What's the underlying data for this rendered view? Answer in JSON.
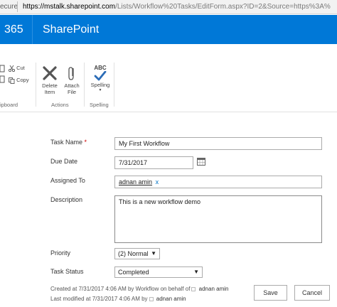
{
  "address_bar": {
    "security": "ecure",
    "url_host": "https://mstalk.sharepoint.com",
    "url_rest": "/Lists/Workflow%20Tasks/EditForm.aspx?ID=2&Source=https%3A%"
  },
  "suite_bar": {
    "product": "365",
    "site": "SharePoint"
  },
  "ribbon": {
    "cut_label": "Cut",
    "copy_label": "Copy",
    "clipboard_group": "ipboard",
    "delete_label": "Delete Item",
    "attach_label": "Attach File",
    "actions_group": "Actions",
    "spelling_abc": "ABC",
    "spelling_label": "Spelling",
    "spelling_group": "Spelling"
  },
  "form": {
    "task_name": {
      "label": "Task Name",
      "required": "*",
      "value": "My First Workflow"
    },
    "due_date": {
      "label": "Due Date",
      "value": "7/31/2017"
    },
    "assigned_to": {
      "label": "Assigned To",
      "value": "adnan amin",
      "remove": "x"
    },
    "description": {
      "label": "Description",
      "value": "This is a new workflow demo"
    },
    "priority": {
      "label": "Priority",
      "value": "(2) Normal"
    },
    "task_status": {
      "label": "Task Status",
      "value": "Completed"
    }
  },
  "footer": {
    "created": "Created at 7/31/2017 4:06 AM  by Workflow on behalf of",
    "created_user": "adnan amin",
    "modified": "Last modified at 7/31/2017 4:06 AM  by",
    "modified_user": "adnan amin",
    "save_label": "Save",
    "cancel_label": "Cancel"
  },
  "colors": {
    "suite_bar": "#0078d7",
    "required": "#cc0000",
    "check_blue": "#2b6cb7",
    "delete_x": "#555555"
  }
}
